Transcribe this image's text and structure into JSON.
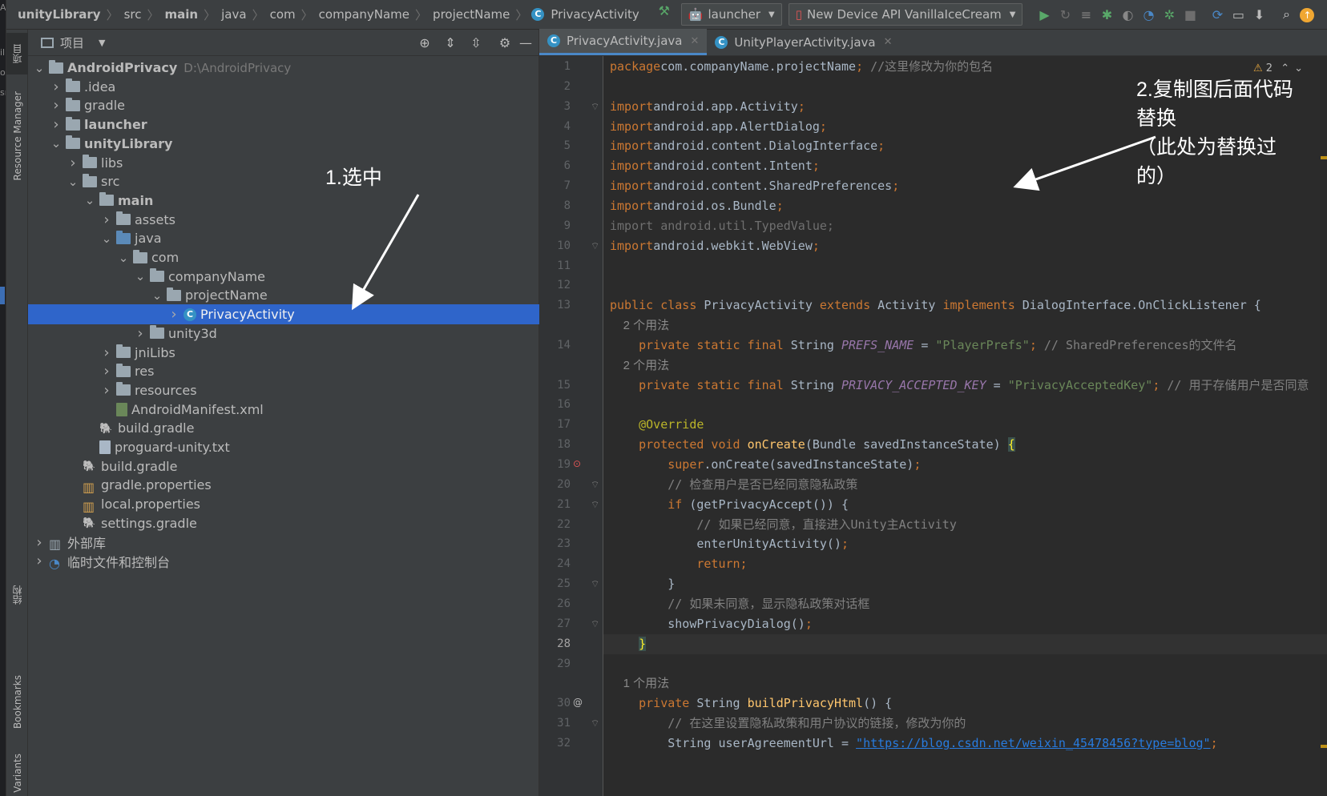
{
  "edge_glyphs": [
    "A",
    "il",
    "o",
    "sr"
  ],
  "breadcrumb": [
    {
      "text": "unityLibrary",
      "bold": true
    },
    {
      "text": "src"
    },
    {
      "text": "main",
      "bold": true
    },
    {
      "text": "java"
    },
    {
      "text": "com"
    },
    {
      "text": "companyName"
    },
    {
      "text": "projectName"
    },
    {
      "text": "PrivacyActivity"
    }
  ],
  "toolbar": {
    "run_config": "launcher",
    "device": "New Device API VanillaIceCream"
  },
  "left_tool_tabs": [
    "项目",
    "Resource Manager",
    "结构",
    "Bookmarks",
    "Variants"
  ],
  "project_panel": {
    "title": "项目"
  },
  "tree": [
    {
      "label": "AndroidPrivacy",
      "path": "D:\\AndroidPrivacy",
      "depth": 0,
      "chev": "v",
      "icon": "folder-module",
      "bold": true
    },
    {
      "label": ".idea",
      "depth": 1,
      "chev": ">",
      "icon": "folder"
    },
    {
      "label": "gradle",
      "depth": 1,
      "chev": ">",
      "icon": "folder"
    },
    {
      "label": "launcher",
      "depth": 1,
      "chev": ">",
      "icon": "folder-module",
      "bold": true
    },
    {
      "label": "unityLibrary",
      "depth": 1,
      "chev": "v",
      "icon": "folder-module",
      "bold": true
    },
    {
      "label": "libs",
      "depth": 2,
      "chev": ">",
      "icon": "folder"
    },
    {
      "label": "src",
      "depth": 2,
      "chev": "v",
      "icon": "folder"
    },
    {
      "label": "main",
      "depth": 3,
      "chev": "v",
      "icon": "folder",
      "bold": true
    },
    {
      "label": "assets",
      "depth": 4,
      "chev": ">",
      "icon": "folder"
    },
    {
      "label": "java",
      "depth": 4,
      "chev": "v",
      "icon": "folder-blue"
    },
    {
      "label": "com",
      "depth": 5,
      "chev": "v",
      "icon": "package"
    },
    {
      "label": "companyName",
      "depth": 6,
      "chev": "v",
      "icon": "package"
    },
    {
      "label": "projectName",
      "depth": 7,
      "chev": "v",
      "icon": "package"
    },
    {
      "label": "PrivacyActivity",
      "depth": 8,
      "chev": ">",
      "icon": "class",
      "selected": true
    },
    {
      "label": "unity3d",
      "depth": 6,
      "chev": ">",
      "icon": "package"
    },
    {
      "label": "jniLibs",
      "depth": 4,
      "chev": ">",
      "icon": "folder"
    },
    {
      "label": "res",
      "depth": 4,
      "chev": ">",
      "icon": "folder"
    },
    {
      "label": "resources",
      "depth": 4,
      "chev": ">",
      "icon": "folder"
    },
    {
      "label": "AndroidManifest.xml",
      "depth": 4,
      "chev": "",
      "icon": "manifest"
    },
    {
      "label": "build.gradle",
      "depth": 3,
      "chev": "",
      "icon": "gradle"
    },
    {
      "label": "proguard-unity.txt",
      "depth": 3,
      "chev": "",
      "icon": "file"
    },
    {
      "label": "build.gradle",
      "depth": 2,
      "chev": "",
      "icon": "gradle"
    },
    {
      "label": "gradle.properties",
      "depth": 2,
      "chev": "",
      "icon": "props"
    },
    {
      "label": "local.properties",
      "depth": 2,
      "chev": "",
      "icon": "props"
    },
    {
      "label": "settings.gradle",
      "depth": 2,
      "chev": "",
      "icon": "gradle"
    },
    {
      "label": "外部库",
      "depth": 0,
      "chev": ">",
      "icon": "libs"
    },
    {
      "label": "临时文件和控制台",
      "depth": 0,
      "chev": ">",
      "icon": "scratch"
    }
  ],
  "tabs": [
    {
      "label": "PrivacyActivity.java",
      "active": true
    },
    {
      "label": "UnityPlayerActivity.java",
      "active": false
    }
  ],
  "warnings": {
    "count": "2"
  },
  "code": [
    {
      "n": "1",
      "t": [
        [
          "kw",
          "package"
        ],
        [
          "",
          "com.companyName.projectName"
        ],
        [
          "kw",
          ";"
        ],
        [
          "cm",
          " //这里修改为你的包名"
        ]
      ]
    },
    {
      "n": "2",
      "t": []
    },
    {
      "n": "3",
      "t": [
        [
          "kw",
          "import"
        ],
        [
          "",
          "android.app.Activity"
        ],
        [
          "kw",
          ";"
        ]
      ]
    },
    {
      "n": "4",
      "t": [
        [
          "kw",
          "import"
        ],
        [
          "",
          "android.app.AlertDialog"
        ],
        [
          "kw",
          ";"
        ]
      ]
    },
    {
      "n": "5",
      "t": [
        [
          "kw",
          "import"
        ],
        [
          "",
          "android.content.DialogInterface"
        ],
        [
          "kw",
          ";"
        ]
      ]
    },
    {
      "n": "6",
      "t": [
        [
          "kw",
          "import"
        ],
        [
          "",
          "android.content.Intent"
        ],
        [
          "kw",
          ";"
        ]
      ]
    },
    {
      "n": "7",
      "t": [
        [
          "kw",
          "import"
        ],
        [
          "",
          "android.content.SharedPreferences"
        ],
        [
          "kw",
          ";"
        ]
      ]
    },
    {
      "n": "8",
      "t": [
        [
          "kw",
          "import"
        ],
        [
          "",
          "android.os.Bundle"
        ],
        [
          "kw",
          ";"
        ]
      ]
    },
    {
      "n": "9",
      "t": [
        [
          "dm",
          "import android.util.TypedValue;"
        ]
      ]
    },
    {
      "n": "10",
      "t": [
        [
          "kw",
          "import"
        ],
        [
          "",
          "android.webkit.WebView"
        ],
        [
          "kw",
          ";"
        ]
      ]
    },
    {
      "n": "11",
      "t": []
    },
    {
      "n": "12",
      "t": []
    },
    {
      "n": "13",
      "t": [
        [
          "kw",
          "public class"
        ],
        [
          "",
          " PrivacyActivity "
        ],
        [
          "kw",
          "extends"
        ],
        [
          "",
          " Activity "
        ],
        [
          "kw",
          "implements"
        ],
        [
          "",
          " DialogInterface.OnClickListener {"
        ]
      ]
    },
    {
      "n": "",
      "hint": "    2 个用法"
    },
    {
      "n": "14",
      "t": [
        [
          "",
          "    "
        ],
        [
          "kw",
          "private static final"
        ],
        [
          "",
          " String "
        ],
        [
          "fld",
          "PREFS_NAME"
        ],
        [
          "",
          " = "
        ],
        [
          "str",
          "\"PlayerPrefs\""
        ],
        [
          "kw",
          ";"
        ],
        [
          "cm",
          " // SharedPreferences的文件名"
        ]
      ]
    },
    {
      "n": "",
      "hint": "    2 个用法"
    },
    {
      "n": "15",
      "t": [
        [
          "",
          "    "
        ],
        [
          "kw",
          "private static final"
        ],
        [
          "",
          " String "
        ],
        [
          "fld",
          "PRIVACY_ACCEPTED_KEY"
        ],
        [
          "",
          " = "
        ],
        [
          "str",
          "\"PrivacyAcceptedKey\""
        ],
        [
          "kw",
          ";"
        ],
        [
          "cm",
          " // 用于存储用户是否同意"
        ]
      ]
    },
    {
      "n": "16",
      "t": []
    },
    {
      "n": "17",
      "t": [
        [
          "",
          "    "
        ],
        [
          "ann",
          "@Override"
        ]
      ]
    },
    {
      "n": "18",
      "t": [
        [
          "",
          "    "
        ],
        [
          "kw",
          "protected void"
        ],
        [
          "",
          " "
        ],
        [
          "fn",
          "onCreate"
        ],
        [
          "",
          "(Bundle savedInstanceState) "
        ],
        [
          "br",
          "{"
        ]
      ]
    },
    {
      "n": "19",
      "t": [
        [
          "",
          "        "
        ],
        [
          "kw",
          "super"
        ],
        [
          "",
          ".onCreate(savedInstanceState)"
        ],
        [
          "kw",
          ";"
        ]
      ]
    },
    {
      "n": "20",
      "t": [
        [
          "cm",
          "        // 检查用户是否已经同意隐私政策"
        ]
      ]
    },
    {
      "n": "21",
      "t": [
        [
          "",
          "        "
        ],
        [
          "kw",
          "if"
        ],
        [
          "",
          " (getPrivacyAccept()) {"
        ]
      ]
    },
    {
      "n": "22",
      "t": [
        [
          "cm",
          "            // 如果已经同意，直接进入Unity主Activity"
        ]
      ]
    },
    {
      "n": "23",
      "t": [
        [
          "",
          "            enterUnityActivity()"
        ],
        [
          "kw",
          ";"
        ]
      ]
    },
    {
      "n": "24",
      "t": [
        [
          "",
          "            "
        ],
        [
          "kw",
          "return;"
        ]
      ]
    },
    {
      "n": "25",
      "t": [
        [
          "",
          "        }"
        ]
      ]
    },
    {
      "n": "26",
      "t": [
        [
          "cm",
          "        // 如果未同意，显示隐私政策对话框"
        ]
      ]
    },
    {
      "n": "27",
      "t": [
        [
          "",
          "        showPrivacyDialog()"
        ],
        [
          "kw",
          ";"
        ]
      ]
    },
    {
      "n": "28",
      "t": [
        [
          "",
          "    "
        ],
        [
          "br",
          "}"
        ]
      ],
      "cur": true
    },
    {
      "n": "29",
      "t": []
    },
    {
      "n": "",
      "hint": "    1 个用法"
    },
    {
      "n": "30",
      "t": [
        [
          "",
          "    "
        ],
        [
          "kw",
          "private"
        ],
        [
          "",
          " String "
        ],
        [
          "fn",
          "buildPrivacyHtml"
        ],
        [
          "",
          "() {"
        ]
      ]
    },
    {
      "n": "31",
      "t": [
        [
          "cm",
          "        // 在这里设置隐私政策和用户协议的链接，修改为你的"
        ]
      ]
    },
    {
      "n": "32",
      "t": [
        [
          "",
          "        String userAgreementUrl = "
        ],
        [
          "url",
          "\"https://blog.csdn.net/weixin_45478456?type=blog\""
        ],
        [
          "kw",
          ";"
        ]
      ]
    }
  ],
  "annotations": {
    "select": "1.选中",
    "replace_lines": [
      "2.复制图后面代码",
      "替换",
      "（此处为替换过",
      "的）"
    ]
  },
  "colors": {
    "keyword": "#cc7832",
    "string": "#6a8759",
    "comment": "#808080",
    "field": "#9876aa",
    "function": "#ffc66d",
    "annotation": "#bbb529",
    "selection": "#2f65ca"
  }
}
